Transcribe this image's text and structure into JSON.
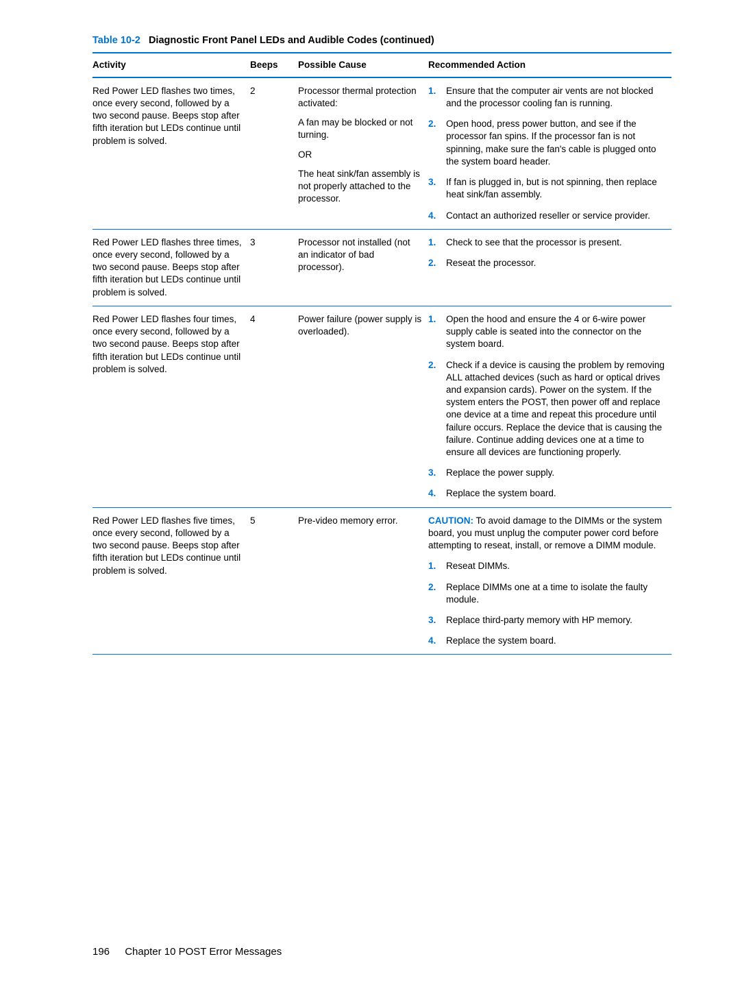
{
  "caption": {
    "number": "Table 10-2",
    "title": "Diagnostic Front Panel LEDs and Audible Codes (continued)"
  },
  "columns": [
    "Activity",
    "Beeps",
    "Possible Cause",
    "Recommended Action"
  ],
  "rows": [
    {
      "activity": "Red Power LED flashes two times, once every second, followed by a two second pause. Beeps stop after fifth iteration but LEDs continue until problem is solved.",
      "beeps": "2",
      "cause": [
        "Processor thermal protection activated:",
        "A fan may be blocked or not turning.",
        "OR",
        "The heat sink/fan assembly is not properly attached to the processor."
      ],
      "actions": [
        "Ensure that the computer air vents are not blocked and the processor cooling fan is running.",
        "Open hood, press power button, and see if the processor fan spins. If the processor fan is not spinning, make sure the fan's cable is plugged onto the system board header.",
        "If fan is plugged in, but is not spinning, then replace heat sink/fan assembly.",
        "Contact an authorized reseller or service provider."
      ]
    },
    {
      "activity": "Red Power LED flashes three times, once every second, followed by a two second pause. Beeps stop after fifth iteration but LEDs continue until problem is solved.",
      "beeps": "3",
      "cause": [
        "Processor not installed (not an indicator of bad processor)."
      ],
      "actions": [
        "Check to see that the processor is present.",
        "Reseat the processor."
      ]
    },
    {
      "activity": "Red Power LED flashes four times, once every second, followed by a two second pause. Beeps stop after fifth iteration but LEDs continue until problem is solved.",
      "beeps": "4",
      "cause": [
        "Power failure (power supply is overloaded)."
      ],
      "actions": [
        "Open the hood and ensure the 4 or 6-wire power supply cable is seated into the connector on the system board.",
        "Check if a device is causing the problem by removing ALL attached devices (such as hard or optical drives and expansion cards). Power on the system. If the system enters the POST, then power off and replace one device at a time and repeat this procedure until failure occurs. Replace the device that is causing the failure. Continue adding devices one at a time to ensure all devices are functioning properly.",
        "Replace the power supply.",
        "Replace the system board."
      ]
    },
    {
      "activity": "Red Power LED flashes five times, once every second, followed by a two second pause. Beeps stop after fifth iteration but LEDs continue until problem is solved.",
      "beeps": "5",
      "cause": [
        "Pre-video memory error."
      ],
      "caution": {
        "label": "CAUTION:",
        "text": "To avoid damage to the DIMMs or the system board, you must unplug the computer power cord before attempting to reseat, install, or remove a DIMM module."
      },
      "actions": [
        "Reseat DIMMs.",
        "Replace DIMMs one at a time to isolate the faulty module.",
        "Replace third-party memory with HP memory.",
        "Replace the system board."
      ]
    }
  ],
  "footer": {
    "page": "196",
    "chapter": "Chapter 10   POST Error Messages"
  }
}
